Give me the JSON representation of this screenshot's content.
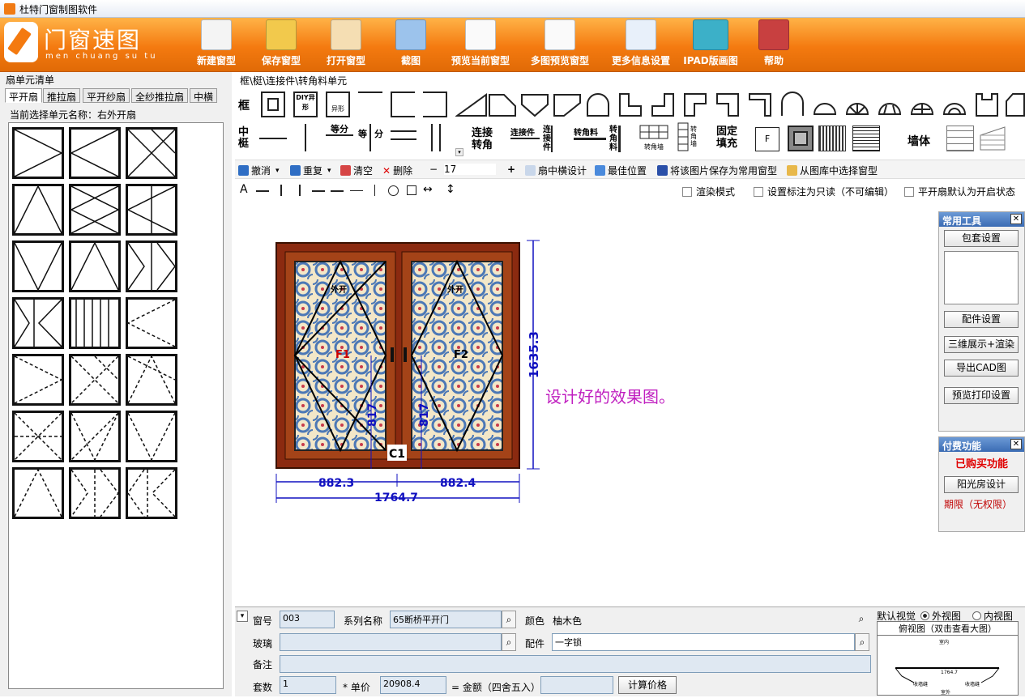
{
  "window": {
    "title": "杜特门窗制图软件"
  },
  "logo": {
    "main": "门窗速图",
    "sub": "men chuang su tu"
  },
  "toolbar": [
    {
      "label": "新建窗型",
      "icon": "new-document-icon"
    },
    {
      "label": "保存窗型",
      "icon": "save-icon"
    },
    {
      "label": "打开窗型",
      "icon": "open-folder-icon"
    },
    {
      "label": "截图",
      "icon": "screenshot-icon"
    },
    {
      "label": "预览当前窗型",
      "icon": "preview-icon"
    },
    {
      "label": "多图预览窗型",
      "icon": "multi-preview-icon"
    },
    {
      "label": "更多信息设置",
      "icon": "settings-check-icon"
    },
    {
      "label": "IPAD版画图",
      "icon": "tablet-icon"
    },
    {
      "label": "帮助",
      "icon": "help-books-icon"
    }
  ],
  "left_panel": {
    "title": "扇单元清单",
    "tabs": [
      "平开扇",
      "推拉扇",
      "平开纱扇",
      "全纱推拉扇",
      "中横"
    ],
    "active_tab": 0,
    "current": "当前选择单元名称：右外开扇"
  },
  "element_bar": {
    "breadcrumb": "框\\梃\\连接件\\转角料单元",
    "row1_label": "框",
    "row2_label": "中梃",
    "diy": "DIY异形",
    "irregular": "异形",
    "split1": "等分",
    "split2": "等",
    "split3": "分",
    "connector": "连接转角",
    "connector2": "连接件",
    "connector3": "连接件",
    "corner": "转角料",
    "corner2": "转角料",
    "corner_wall": "转角墙",
    "corner_wall2": "转角墙",
    "fill": "固定填充",
    "fill_f": "F",
    "wall": "墙体"
  },
  "edit_bar": {
    "undo": "撤消",
    "redo": "重复",
    "clear": "清空",
    "delete": "删除",
    "minus": "−",
    "font_size": "17",
    "plus": "+",
    "mid_design": "扇中横设计",
    "best_pos": "最佳位置",
    "save_common": "将该图片保存为常用窗型",
    "from_lib": "从图库中选择窗型"
  },
  "draw_bar": {
    "text_tool": "A",
    "options": [
      "渲染模式",
      "设置标注为只读（不可编辑）",
      "平开扇默认为开启状态"
    ]
  },
  "drawing": {
    "sash_left": "F1",
    "sash_right": "F2",
    "open_left": "外开",
    "open_right": "外开",
    "corner": "C1",
    "height": "1635.3",
    "half_h_left": "817",
    "half_h_right": "817",
    "width_left": "882.3",
    "width_right": "882.4",
    "width_total": "1764.7",
    "note": "设计好的效果图。",
    "colors": {
      "frame": "#8b2a10",
      "dim": "#1010c0",
      "note": "#c020c0"
    }
  },
  "common_tools": {
    "title": "常用工具",
    "close": "✕",
    "buttons": [
      "包套设置",
      "配件设置",
      "三维展示+渲染",
      "导出CAD图",
      "预览打印设置"
    ]
  },
  "paid": {
    "title": "付费功能",
    "close": "✕",
    "status": "已购买功能",
    "button": "阳光房设计",
    "period": "期限（无权限）"
  },
  "bottom": {
    "window_no_label": "窗号",
    "window_no": "003",
    "series_label": "系列名称",
    "series": "65断桥平开门",
    "color_label": "颜色",
    "color": "柚木色",
    "glass_label": "玻璃",
    "glass": "",
    "hardware_label": "配件",
    "hardware": "一字锁",
    "remark_label": "备注",
    "remark": "",
    "sets_label": "套数",
    "sets": "1",
    "price_label": "* 单价",
    "price": "20908.4",
    "amount_label": "= 金额（四舍五入）",
    "amount": "",
    "calc_button": "计算价格",
    "view_label": "默认视觉",
    "view_out": "外视图",
    "view_in": "内视图",
    "plan_label": "俯视图（双击查看大图）",
    "plan_top": "室内",
    "plan_bottom": "室外",
    "plan_dim": "1764.7",
    "plan_l": "收墙缝",
    "plan_r": "收墙缝"
  }
}
